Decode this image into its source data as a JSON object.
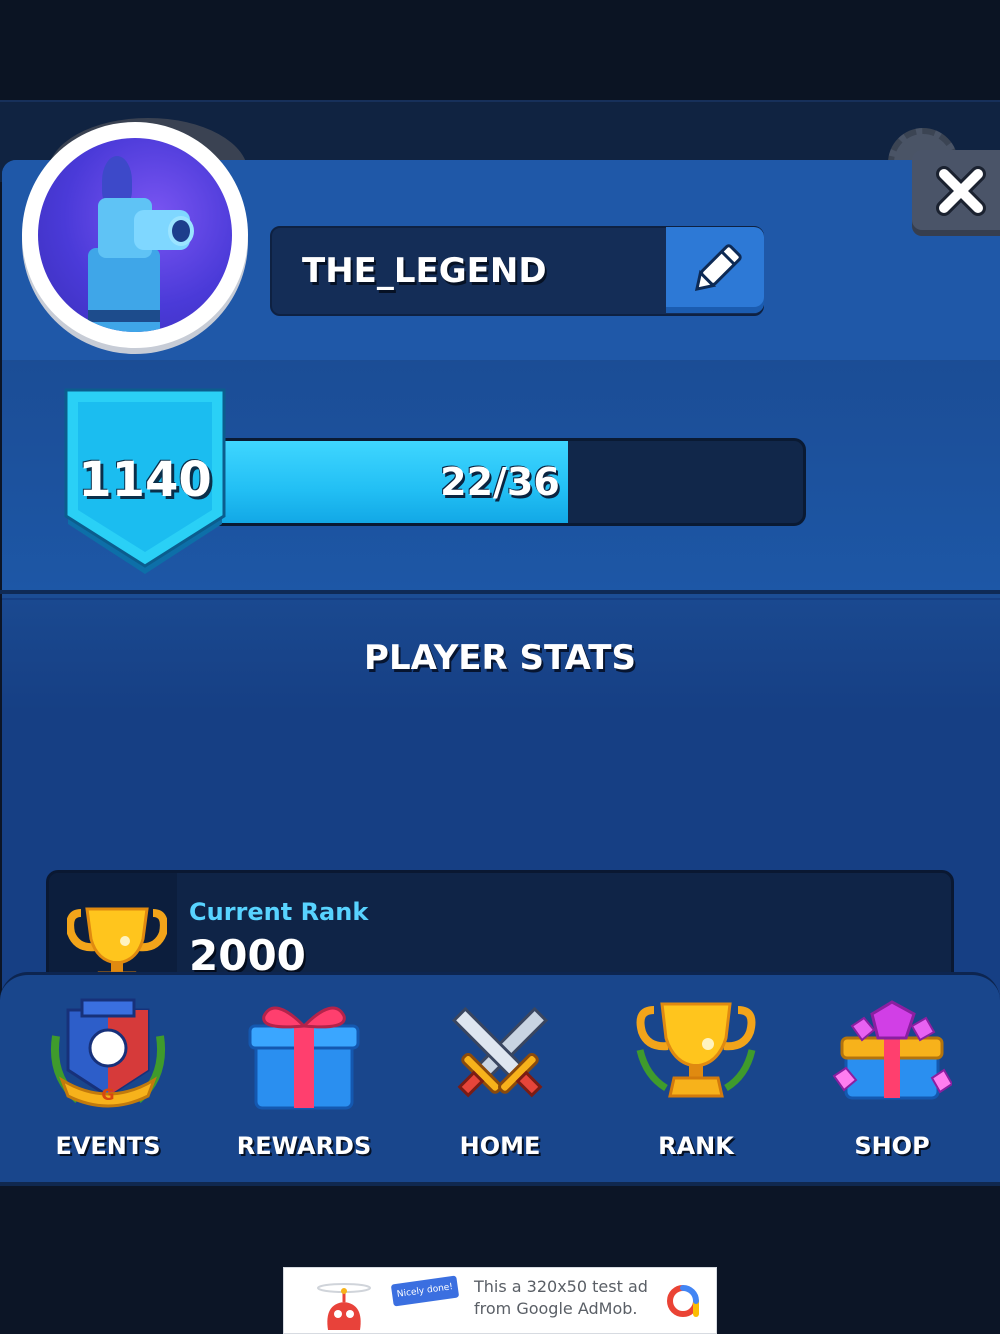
{
  "profile": {
    "player_name": "THE_LEGEND",
    "avatar_icon": "cannon-knight-avatar",
    "edit_icon": "pencil-icon",
    "close_icon": "close-icon"
  },
  "level": {
    "value": "1140",
    "xp_text": "22/36",
    "xp_current": 22,
    "xp_max": 36
  },
  "stats": {
    "title": "PLAYER STATS",
    "items": [
      {
        "label": "Current Rank",
        "value": "2000",
        "icon": "trophy-icon"
      }
    ]
  },
  "nav": {
    "items": [
      {
        "label": "EVENTS",
        "icon": "events-shield-icon"
      },
      {
        "label": "REWARDS",
        "icon": "gift-icon"
      },
      {
        "label": "HOME",
        "icon": "crossed-swords-icon"
      },
      {
        "label": "RANK",
        "icon": "trophy-icon"
      },
      {
        "label": "SHOP",
        "icon": "gem-chest-icon"
      }
    ]
  },
  "ad": {
    "line1": "This a 320x50 test ad",
    "line2": "from Google AdMob.",
    "ribbon": "Nicely done!"
  },
  "colors": {
    "panel_blue": "#1c4d94",
    "accent_cyan": "#22bff4",
    "label_cyan": "#58d3ff",
    "gold": "#f7b21b"
  }
}
